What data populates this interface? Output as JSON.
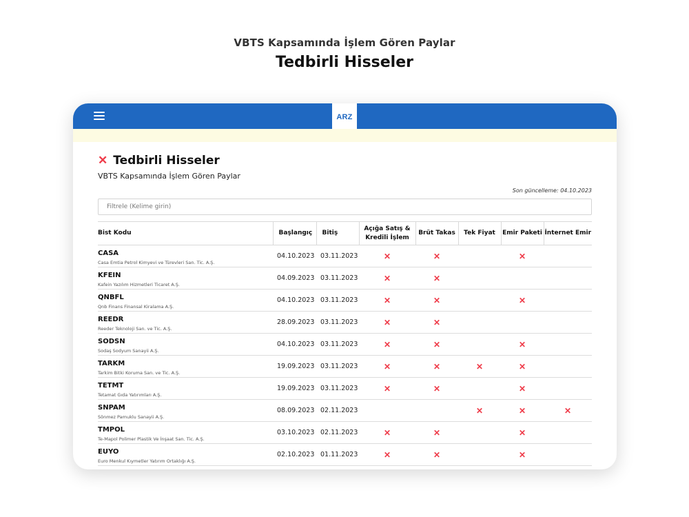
{
  "hero": {
    "subtitle": "VBTS Kapsamında İşlem Gören Paylar",
    "title": "Tedbirli Hisseler"
  },
  "header": {
    "menu_icon": "hamburger-icon",
    "logo": "ARZ",
    "brand_color": "#1f68c1",
    "banner_color": "#fdfbe2"
  },
  "page": {
    "title_icon": "x-icon",
    "title": "Tedbirli Hisseler",
    "subtitle": "VBTS Kapsamında İşlem Gören Paylar",
    "updated": "Son güncelleme: 04.10.2023"
  },
  "filter": {
    "placeholder": "Filtrele (Kelime girin)",
    "value": ""
  },
  "table": {
    "mark_color": "#ef3c4a",
    "mark_symbol": "✕",
    "headers": {
      "code": "Bist Kodu",
      "start": "Başlangıç",
      "end": "Bitiş",
      "short": "Açığa Satış & Kredili İşlem",
      "gross": "Brüt Takas",
      "single": "Tek Fiyat",
      "order": "Emir Paketi",
      "internet": "İnternet Emir"
    },
    "rows": [
      {
        "code": "CASA",
        "name": "Casa Emtia Petrol Kimyevi ve Türevleri San. Tic. A.Ş.",
        "start": "04.10.2023",
        "end": "03.11.2023",
        "short": true,
        "gross": true,
        "single": false,
        "order": true,
        "internet": false
      },
      {
        "code": "KFEIN",
        "name": "Kafein Yazılım Hizmetleri Ticaret A.Ş.",
        "start": "04.09.2023",
        "end": "03.11.2023",
        "short": true,
        "gross": true,
        "single": false,
        "order": false,
        "internet": false
      },
      {
        "code": "QNBFL",
        "name": "Qnb Finans Finansal Kiralama A.Ş.",
        "start": "04.10.2023",
        "end": "03.11.2023",
        "short": true,
        "gross": true,
        "single": false,
        "order": true,
        "internet": false
      },
      {
        "code": "REEDR",
        "name": "Reeder Teknoloji San. ve Tic. A.Ş.",
        "start": "28.09.2023",
        "end": "03.11.2023",
        "short": true,
        "gross": true,
        "single": false,
        "order": false,
        "internet": false
      },
      {
        "code": "SODSN",
        "name": "Sodaş Sodyum Sanayii A.Ş.",
        "start": "04.10.2023",
        "end": "03.11.2023",
        "short": true,
        "gross": true,
        "single": false,
        "order": true,
        "internet": false
      },
      {
        "code": "TARKM",
        "name": "Tarkim Bitki Koruma San. ve Tic. A.Ş.",
        "start": "19.09.2023",
        "end": "03.11.2023",
        "short": true,
        "gross": true,
        "single": true,
        "order": true,
        "internet": false
      },
      {
        "code": "TETMT",
        "name": "Tetamat Gıda Yatırımları A.Ş.",
        "start": "19.09.2023",
        "end": "03.11.2023",
        "short": true,
        "gross": true,
        "single": false,
        "order": true,
        "internet": false
      },
      {
        "code": "SNPAM",
        "name": "Sönmez Pamuklu Sanayii A.Ş.",
        "start": "08.09.2023",
        "end": "02.11.2023",
        "short": false,
        "gross": false,
        "single": true,
        "order": true,
        "internet": true
      },
      {
        "code": "TMPOL",
        "name": "Te-Mapol Polimer Plastik Ve İnşaat San. Tic. A.Ş.",
        "start": "03.10.2023",
        "end": "02.11.2023",
        "short": true,
        "gross": true,
        "single": false,
        "order": true,
        "internet": false
      },
      {
        "code": "EUYO",
        "name": "Euro Menkul Kıymetler Yatırım Ortaklığı A.Ş.",
        "start": "02.10.2023",
        "end": "01.11.2023",
        "short": true,
        "gross": true,
        "single": false,
        "order": true,
        "internet": false
      }
    ]
  }
}
